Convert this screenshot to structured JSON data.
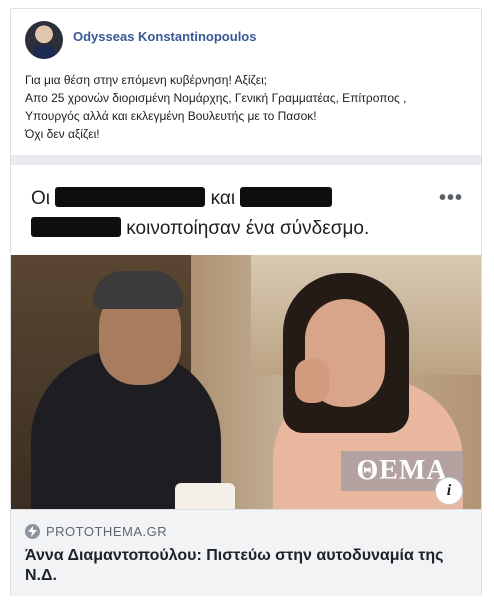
{
  "post": {
    "author": "Odysseas Konstantinopoulos",
    "lines": [
      "Για μια θέση στην επόμενη κυβέρνηση! Αξίζει;",
      "Απο 25 χρονών διορισμένη Νομάρχης, Γενική Γραμματέας, Επίτροπος ,",
      "Υπουργός αλλά και εκλεγμένη Βουλευτής με το Πασοκ!",
      "Όχι δεν αξίζει!"
    ]
  },
  "shared": {
    "prefix": "Οι",
    "conjunction": "και",
    "suffix": "κοινοποίησαν ένα σύνδεσμο.",
    "more_icon": "more-dots-icon"
  },
  "preview": {
    "logo_text": "ΘΕΜΑ",
    "info_label": "i",
    "domain": "PROTOTHEMA.GR",
    "headline": "Άννα Διαμαντοπούλου: Πιστεύω στην αυτοδυναμία της Ν.Δ."
  }
}
